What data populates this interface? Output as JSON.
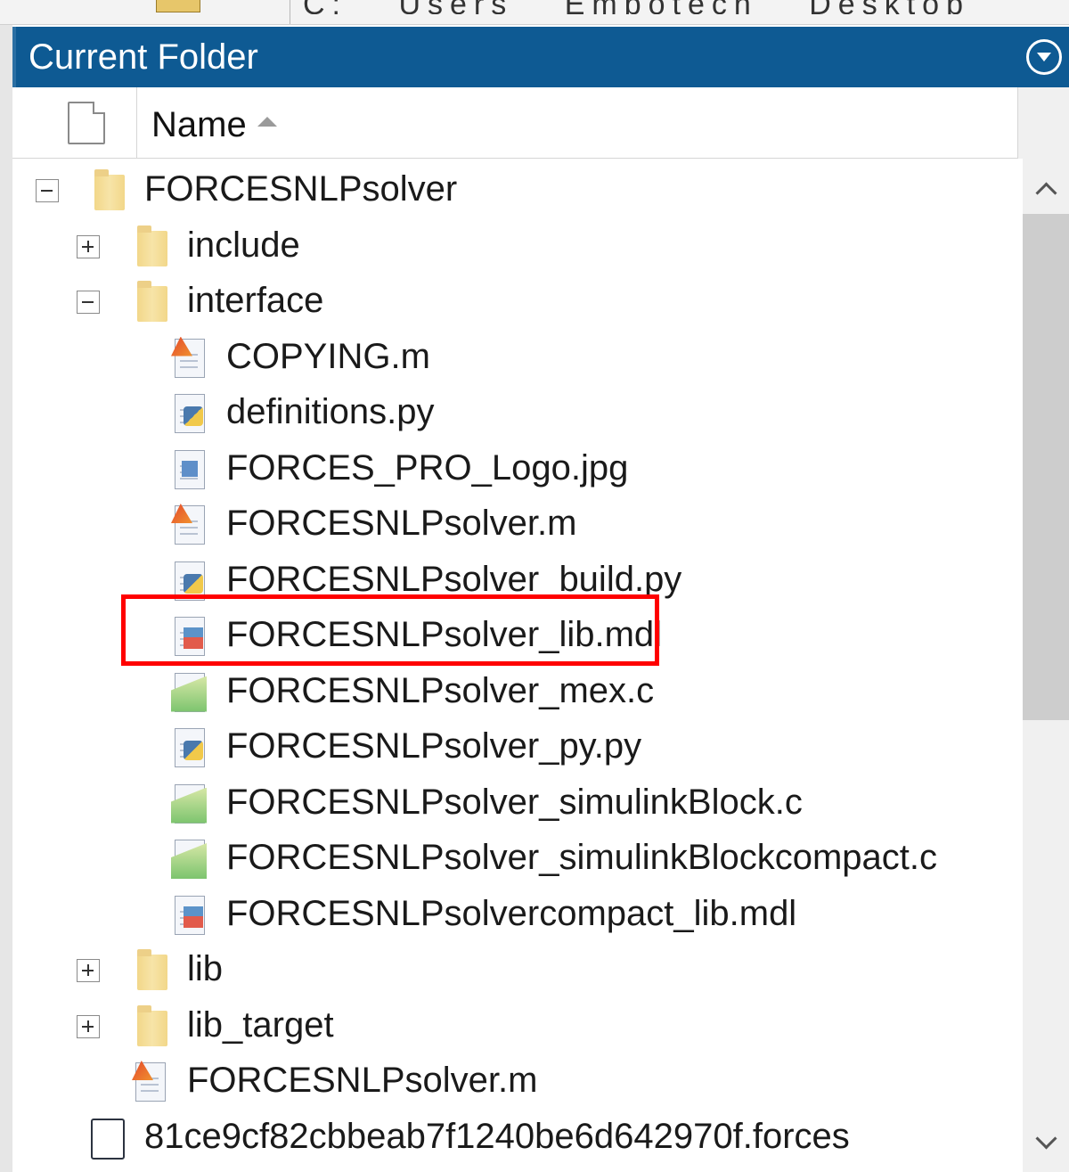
{
  "toolbar": {
    "address_segments": [
      "C:",
      "Users",
      "Embotech",
      "Desktop"
    ]
  },
  "panel": {
    "title": "Current Folder",
    "column_name": "Name"
  },
  "tree": [
    {
      "label": "FORCESNLPsolver",
      "kind": "folder",
      "expanded": true,
      "depth": 0
    },
    {
      "label": "include",
      "kind": "folder",
      "expanded": false,
      "depth": 1
    },
    {
      "label": "interface",
      "kind": "folder",
      "expanded": true,
      "depth": 1
    },
    {
      "label": "COPYING.m",
      "kind": "matlab",
      "depth": 2
    },
    {
      "label": "definitions.py",
      "kind": "python",
      "depth": 2
    },
    {
      "label": "FORCES_PRO_Logo.jpg",
      "kind": "image",
      "depth": 2
    },
    {
      "label": "FORCESNLPsolver.m",
      "kind": "matlab",
      "depth": 2
    },
    {
      "label": "FORCESNLPsolver_build.py",
      "kind": "python",
      "depth": 2
    },
    {
      "label": "FORCESNLPsolver_lib.mdl",
      "kind": "simulink-model",
      "depth": 2,
      "highlighted": true
    },
    {
      "label": "FORCESNLPsolver_mex.c",
      "kind": "c-source",
      "depth": 2
    },
    {
      "label": "FORCESNLPsolver_py.py",
      "kind": "python",
      "depth": 2
    },
    {
      "label": "FORCESNLPsolver_simulinkBlock.c",
      "kind": "c-source",
      "depth": 2
    },
    {
      "label": "FORCESNLPsolver_simulinkBlockcompact.c",
      "kind": "c-source",
      "depth": 2
    },
    {
      "label": "FORCESNLPsolvercompact_lib.mdl",
      "kind": "simulink-model",
      "depth": 2
    },
    {
      "label": "lib",
      "kind": "folder",
      "expanded": false,
      "depth": 1
    },
    {
      "label": "lib_target",
      "kind": "folder",
      "expanded": false,
      "depth": 1
    },
    {
      "label": "FORCESNLPsolver.m",
      "kind": "matlab",
      "depth": 1
    },
    {
      "label": "81ce9cf82cbbeab7f1240be6d642970f.forces",
      "kind": "document",
      "depth": 0
    }
  ],
  "colors": {
    "title_bar": "#0e5a93",
    "highlight_border": "#ff0000"
  }
}
